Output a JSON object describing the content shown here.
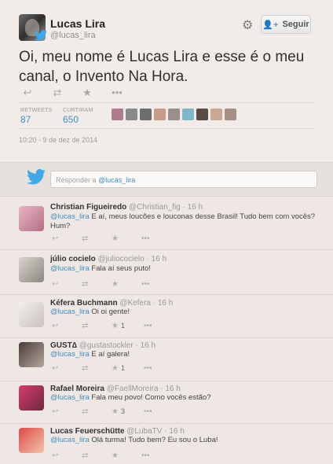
{
  "tweet": {
    "name": "Lucas Lira",
    "handle": "@lucas_lira",
    "follow_label": "Seguir",
    "text": "Oi, meu nome é Lucas Lira e esse é o meu canal, o Invento Na Hora.",
    "retweets_label": "RETWEETS",
    "retweets": "87",
    "likes_label": "CURTIRAM",
    "likes": "650",
    "timestamp": "10:20 - 9 de dez de 2014"
  },
  "reply_box": {
    "prefix": "Responder a",
    "mention": "@lucas_lira"
  },
  "replies": [
    {
      "name": "Christian Figueiredo",
      "handle": "@Christian_fig",
      "time": "· 16 h",
      "mention": "@lucas_lira",
      "text": " E aí, meus loucões e louconas desse Brasil! Tudo bem com vocês? Hum?",
      "count": ""
    },
    {
      "name": "júlio cocielo",
      "handle": "@juliococielo",
      "time": "· 16 h",
      "mention": "@lucas_lira",
      "text": " Fala aí seus puto!",
      "count": ""
    },
    {
      "name": "Kéfera Buchmann",
      "handle": "@Kefera",
      "time": "· 16 h",
      "mention": "@lucas_lira",
      "text": " Oi oi gente!",
      "count": "1"
    },
    {
      "name": "GUST∆",
      "handle": "@gustastockler",
      "time": "· 16 h",
      "mention": "@lucas_lira",
      "text": " E aí galera!",
      "count": "1"
    },
    {
      "name": "Rafael Moreira",
      "handle": "@FaellMoreira",
      "time": "· 16 h",
      "mention": "@lucas_lira",
      "text": " Fala meu povo! Como vocês estão?",
      "count": "3"
    },
    {
      "name": "Lucas Feuerschütte",
      "handle": "@LubaTV",
      "time": "· 16 h",
      "mention": "@lucas_lira",
      "text": " Olá turma! Tudo bem? Eu sou o Luba!",
      "count": ""
    }
  ],
  "icons": [
    "reply-icon",
    "retweet-icon",
    "favorite-icon",
    "more-icon",
    "gear-icon",
    "twitter-bird-icon",
    "follow-person-icon"
  ],
  "colors": {
    "link": "#3d8fc5",
    "twitter_blue": "#3fa8e6",
    "background": "#efe7e3"
  }
}
